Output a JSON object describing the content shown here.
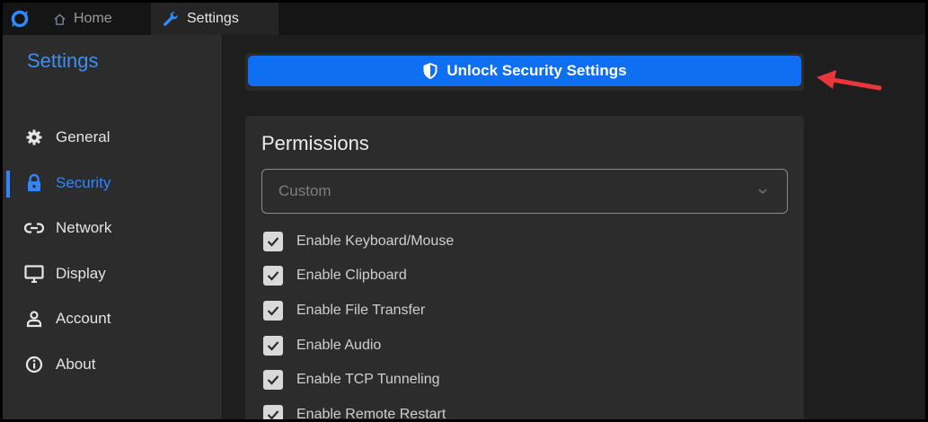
{
  "tabs": [
    {
      "label": "Home",
      "icon": "home-icon"
    },
    {
      "label": "Settings",
      "icon": "wrench-icon"
    }
  ],
  "sidebar": {
    "title": "Settings",
    "items": [
      {
        "label": "General",
        "icon": "gear-icon"
      },
      {
        "label": "Security",
        "icon": "lock-icon",
        "active": true
      },
      {
        "label": "Network",
        "icon": "link-icon"
      },
      {
        "label": "Display",
        "icon": "monitor-icon"
      },
      {
        "label": "Account",
        "icon": "user-icon"
      },
      {
        "label": "About",
        "icon": "info-icon"
      }
    ]
  },
  "main": {
    "unlock_button": {
      "label": "Unlock Security Settings",
      "icon": "shield-icon"
    },
    "permissions": {
      "title": "Permissions",
      "preset": {
        "value": "Custom"
      },
      "options": [
        {
          "label": "Enable Keyboard/Mouse",
          "checked": true
        },
        {
          "label": "Enable Clipboard",
          "checked": true
        },
        {
          "label": "Enable File Transfer",
          "checked": true
        },
        {
          "label": "Enable Audio",
          "checked": true
        },
        {
          "label": "Enable TCP Tunneling",
          "checked": true
        },
        {
          "label": "Enable Remote Restart",
          "checked": true
        }
      ]
    }
  },
  "colors": {
    "accent": "#2f86ff",
    "button": "#0f6ff3",
    "annotation_arrow": "#e8363a"
  }
}
